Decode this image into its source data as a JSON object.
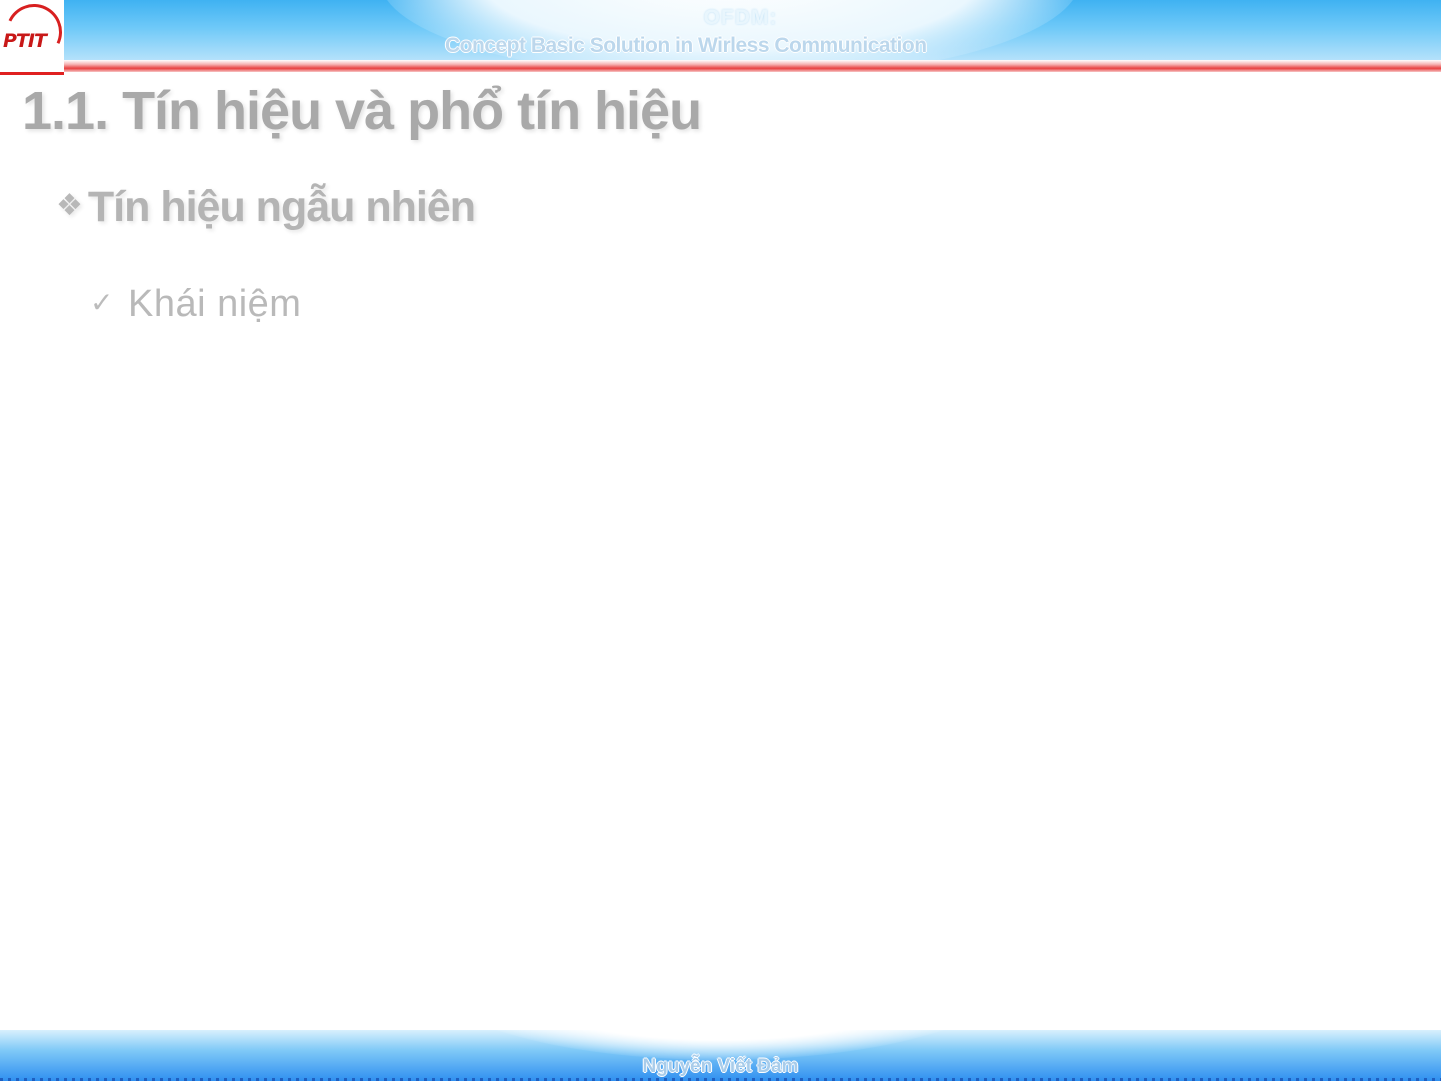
{
  "header": {
    "logo_text": "PTIT",
    "title": "OFDM:",
    "subtitle": "Concept  Basic  Solution in Wirless Communication"
  },
  "slide": {
    "title": "1.1. Tín hiệu và phổ tín hiệu",
    "bullets": [
      {
        "marker": "❖",
        "text": "Tín hiệu ngẫu nhiên"
      },
      {
        "marker": "✓",
        "text": "Khái niệm"
      }
    ]
  },
  "footer": {
    "author": "Nguyễn Viết Đảm"
  },
  "colors": {
    "header_blue": "#3fb2f2",
    "accent_red": "#e02020",
    "footer_blue": "#2f8ff0",
    "text_gray": "#a9a9a9"
  }
}
